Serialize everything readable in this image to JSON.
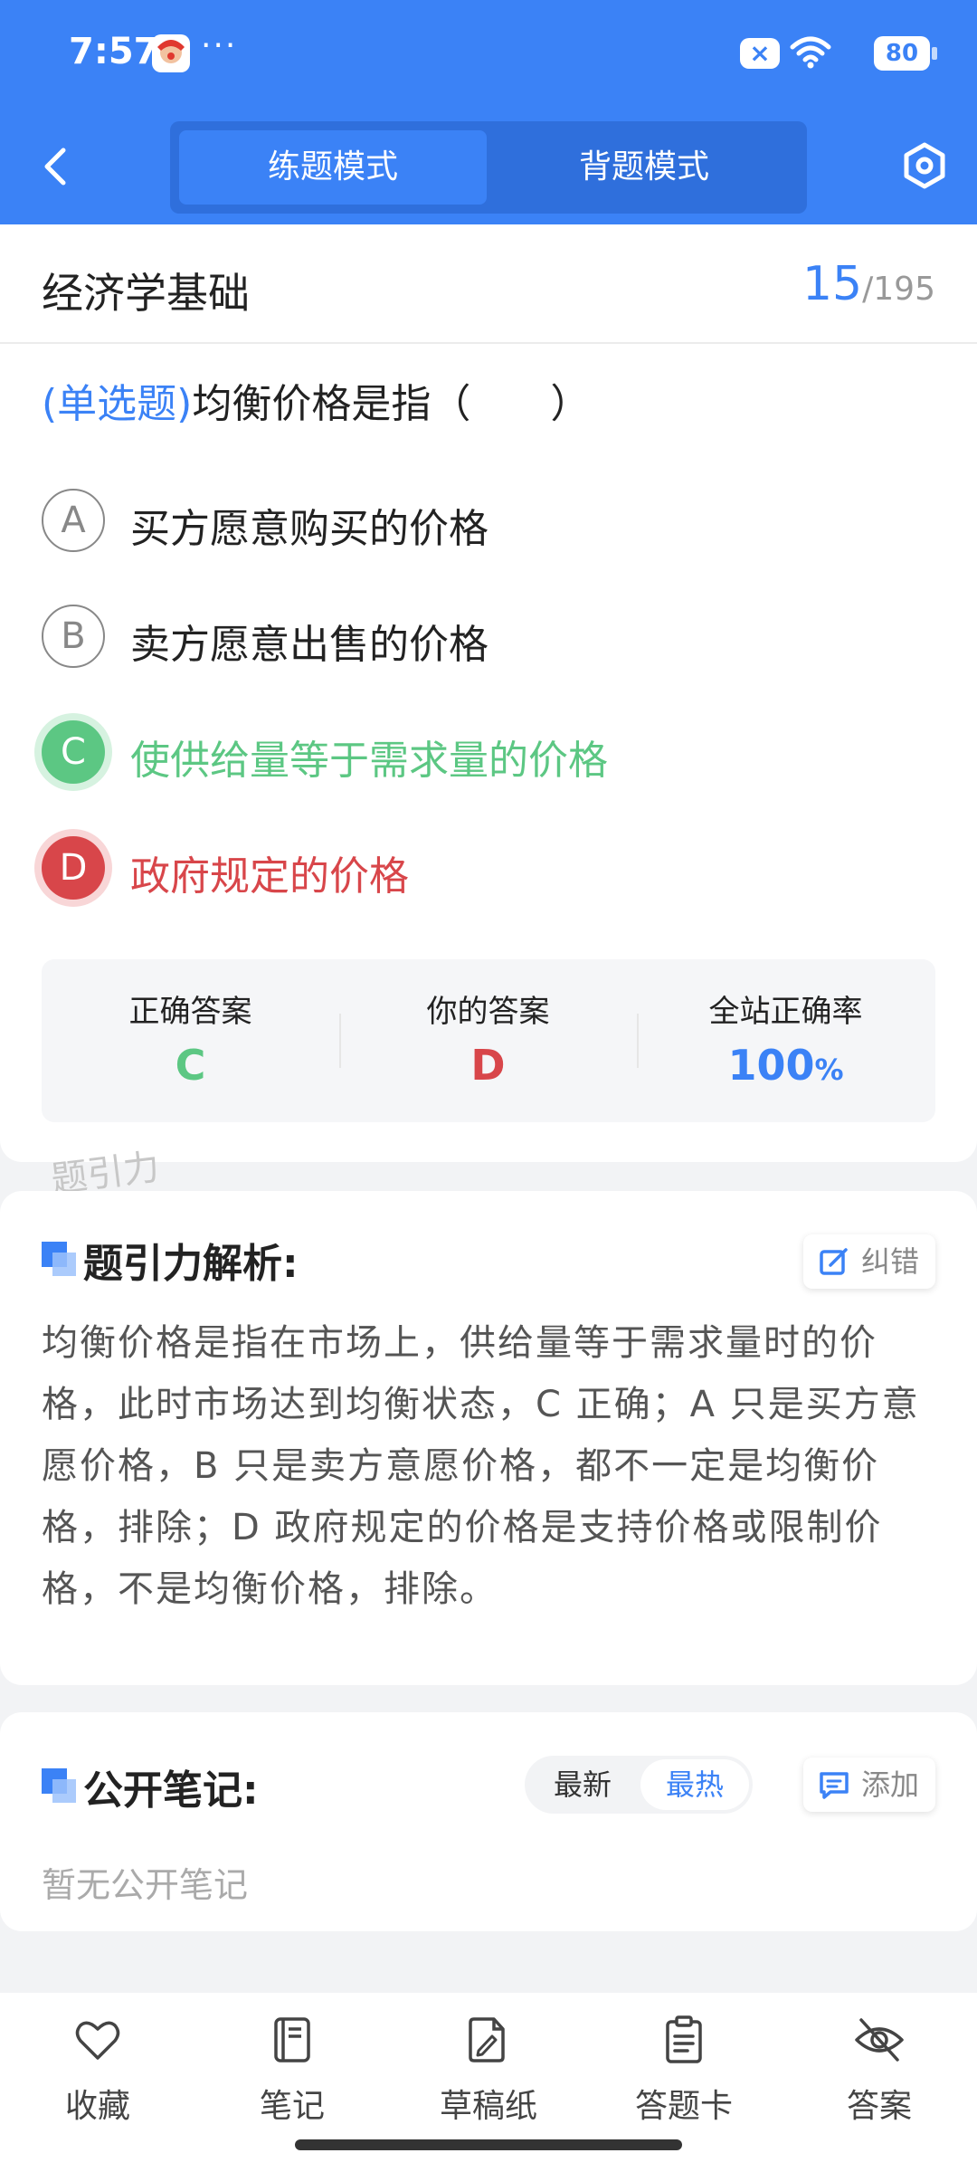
{
  "status_bar": {
    "time": "7:57",
    "dots": "···",
    "x_icon": "×",
    "battery": "80"
  },
  "header": {
    "tabs": [
      {
        "label": "练题模式",
        "active": true
      },
      {
        "label": "背题模式",
        "active": false
      }
    ],
    "accent_color": "#3b82f6"
  },
  "quiz": {
    "subject": "经济学基础",
    "current": "15",
    "separator": "/",
    "total": "195",
    "question_type": "(单选题)",
    "question_text": "均衡价格是指（　　）",
    "options": [
      {
        "letter": "A",
        "text": "买方愿意购买的价格",
        "state": "normal"
      },
      {
        "letter": "B",
        "text": "卖方愿意出售的价格",
        "state": "normal"
      },
      {
        "letter": "C",
        "text": "使供给量等于需求量的价格",
        "state": "correct"
      },
      {
        "letter": "D",
        "text": "政府规定的价格",
        "state": "wrong"
      }
    ],
    "stats": {
      "correct_label": "正确答案",
      "correct_value": "C",
      "yours_label": "你的答案",
      "yours_value": "D",
      "rate_label": "全站正确率",
      "rate_value": "100",
      "rate_unit": "%"
    },
    "colors": {
      "correct": "#5cc783",
      "wrong": "#d8464a"
    }
  },
  "watermark": "题引力",
  "analysis": {
    "title": "题引力解析:",
    "report_button": "纠错",
    "body": "均衡价格是指在市场上，供给量等于需求量时的价格，此时市场达到均衡状态，C 正确；A 只是买方意愿价格，B 只是卖方意愿价格，都不一定是均衡价格，排除；D 政府规定的价格是支持价格或限制价格，不是均衡价格，排除。"
  },
  "notes": {
    "title": "公开笔记:",
    "sort_options": [
      "最新",
      "最热"
    ],
    "selected_sort": "最热",
    "add_button": "添加",
    "empty_text": "暂无公开笔记"
  },
  "bottom_tabs": [
    {
      "label": "收藏",
      "icon": "heart-icon"
    },
    {
      "label": "笔记",
      "icon": "notebook-icon"
    },
    {
      "label": "草稿纸",
      "icon": "draft-paper-icon"
    },
    {
      "label": "答题卡",
      "icon": "answer-sheet-icon"
    },
    {
      "label": "答案",
      "icon": "eye-off-icon"
    }
  ]
}
